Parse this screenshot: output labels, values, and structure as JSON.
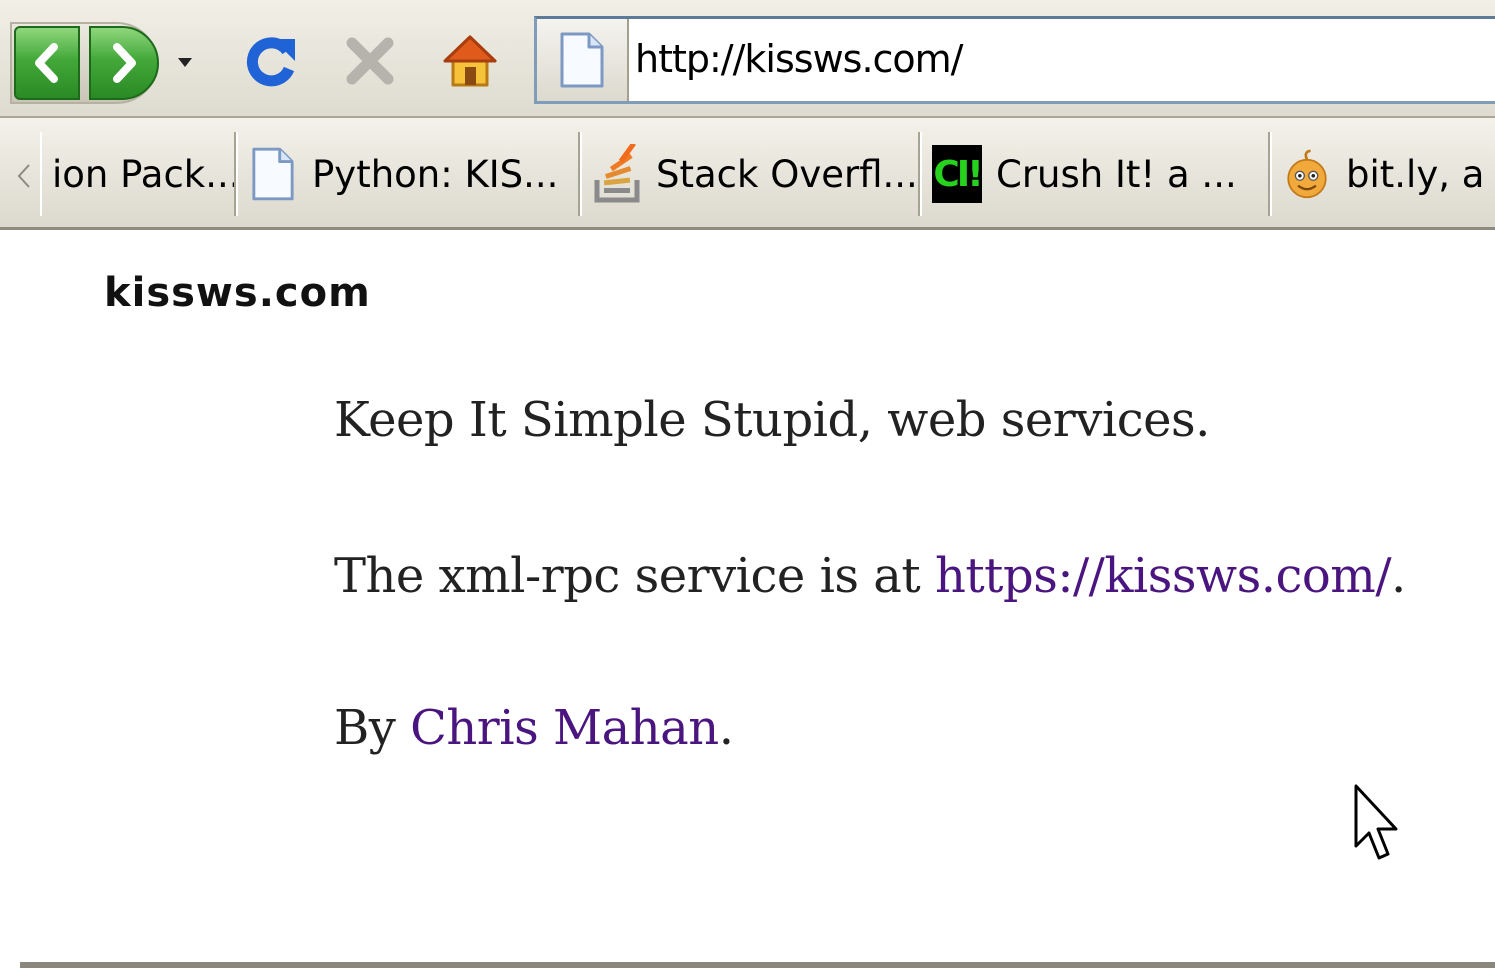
{
  "toolbar": {
    "back_label": "Back",
    "forward_label": "Forward",
    "url": "http://kissws.com/"
  },
  "bookmarks": [
    {
      "label": "ion Pack...",
      "icon": "none"
    },
    {
      "label": "Python: KIS...",
      "icon": "page-icon"
    },
    {
      "label": "Stack Overfl...",
      "icon": "stackoverflow-icon"
    },
    {
      "label": "Crush It! a ...",
      "icon": "ci-badge",
      "badge_text": "CI!"
    },
    {
      "label": "bit.ly, a",
      "icon": "bitly-icon"
    }
  ],
  "page": {
    "site_title": "kissws.com",
    "tagline": "Keep It Simple Stupid, web services.",
    "service_prefix": "The xml-rpc service is at ",
    "service_link": "https://kissws.com/",
    "service_suffix": ".",
    "author_prefix": "By ",
    "author_link": "Chris Mahan",
    "author_suffix": "."
  },
  "colors": {
    "link": "#4b1580",
    "nav_green": "#43a83a",
    "reload_blue": "#1f63d6",
    "toolbar_bg": "#dedbd0"
  }
}
